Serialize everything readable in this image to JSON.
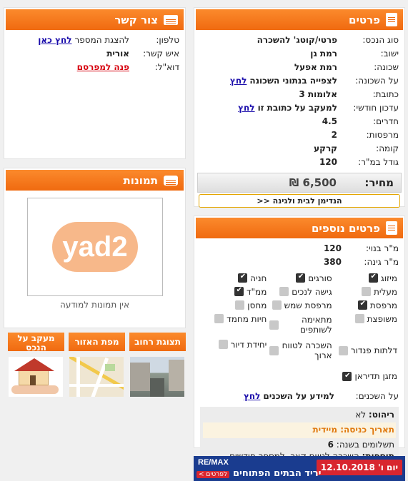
{
  "details": {
    "title": "פרטים",
    "rows": [
      {
        "label": "סוג הנכס:",
        "value": "פרטי/קוטג' להשכרה"
      },
      {
        "label": "ישוב:",
        "value": "רמת גן"
      },
      {
        "label": "שכונה:",
        "value": "רמת אפעל"
      },
      {
        "label": "על השכונה:",
        "value": "לצפייה בנתוני השכונה",
        "link": "לחץ"
      },
      {
        "label": "כתובת:",
        "value": "אלומות 3"
      },
      {
        "label": "עדכון חודשי:",
        "value": "למעקב על כתובת זו",
        "link": "לחץ"
      },
      {
        "label": "חדרים:",
        "value": "4.5"
      },
      {
        "label": "מרפסות:",
        "value": "2"
      },
      {
        "label": "קומה:",
        "value": "קרקע"
      },
      {
        "label": "גודל במ\"ר:",
        "value": "120"
      }
    ],
    "price_label": "מחיר:",
    "price_value": "6,500 ₪",
    "garden_button": "הנדימן לבית ולגינה <<"
  },
  "contact": {
    "title": "צור קשר",
    "phone_label": "טלפון:",
    "phone_text": "להצגת המספר",
    "phone_link": "לחץ כאן",
    "person_label": "איש קשר:",
    "person_value": "אורית",
    "email_label": "דוא\"ל:",
    "email_link": "פנה למפרסם"
  },
  "photos": {
    "title": "תמונות",
    "logo": "yad2",
    "no_photos": "אין תמונות למודעה"
  },
  "tabs": [
    {
      "label": "תצוגת רחוב"
    },
    {
      "label": "מפת האזור"
    },
    {
      "label": "מעקב על הנכס"
    }
  ],
  "extra": {
    "title": "פרטים נוספים",
    "built_label": "מ\"ר בנוי:",
    "built_value": "120",
    "garden_label": "מ\"ר גינה:",
    "garden_value": "380",
    "features": [
      {
        "label": "מיזוג",
        "on": true
      },
      {
        "label": "סורגים",
        "on": true
      },
      {
        "label": "חניה",
        "on": true
      },
      {
        "label": "מעלית",
        "on": false
      },
      {
        "label": "גישה לנכים",
        "on": false
      },
      {
        "label": "ממ\"ד",
        "on": true
      },
      {
        "label": "מרפסת",
        "on": true
      },
      {
        "label": "מרפסת שמש",
        "on": false
      },
      {
        "label": "מחסן",
        "on": false
      },
      {
        "label": "משופצת",
        "on": false
      },
      {
        "label": "מתאימה לשותפים",
        "on": false
      },
      {
        "label": "חיות מחמד",
        "on": false
      },
      {
        "label": "דלתות פנדור",
        "on": false
      },
      {
        "label": "השכרה לטווח ארוך",
        "on": false
      },
      {
        "label": "יחידת דיור",
        "on": false
      },
      {
        "label": "מזגן תדיראן",
        "on": true
      }
    ],
    "neighbors_label": "על השכנים:",
    "neighbors_text": "למידע על השכנים",
    "neighbors_link": "לחץ",
    "furniture_label": "ריהוט:",
    "furniture_value": "לא",
    "entry_label": "תאריך כניסה:",
    "entry_value": "מיידית",
    "payments_label": "תשלומים בשנה:",
    "payments_value": "6",
    "additions_label": "תוספות:",
    "additions_value": "השכרה לטווח קצר, למספר חודשים."
  },
  "banner": {
    "date": "יום ו' 12.10.2018",
    "brand": "RE/MAX",
    "headline": "יריד הבתים הפתוחים",
    "cta": "לפרטים >"
  },
  "colors": {
    "accent": "#f06a10",
    "link": "#1a0dab",
    "red": "#d6000d"
  }
}
